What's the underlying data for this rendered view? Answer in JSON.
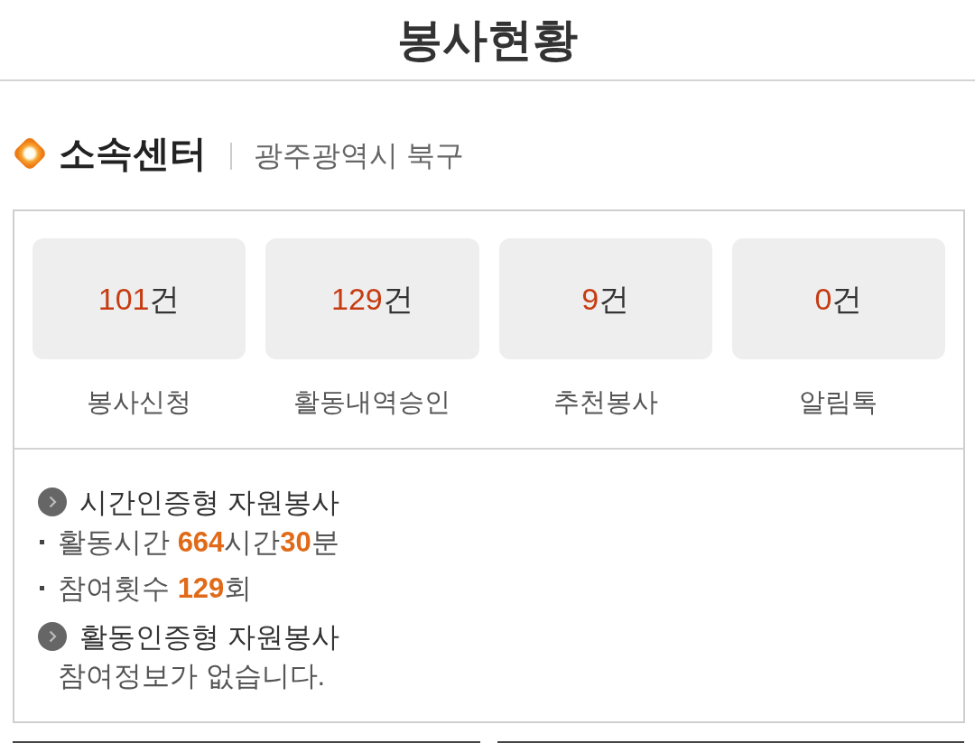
{
  "header": {
    "title": "봉사현황"
  },
  "center": {
    "label": "소속센터",
    "value": "광주광역시 북구"
  },
  "stats": [
    {
      "count": "101",
      "unit": "건",
      "label": "봉사신청"
    },
    {
      "count": "129",
      "unit": "건",
      "label": "활동내역승인"
    },
    {
      "count": "9",
      "unit": "건",
      "label": "추천봉사"
    },
    {
      "count": "0",
      "unit": "건",
      "label": "알림톡"
    }
  ],
  "records": [
    {
      "title": "시간인증형 자원봉사",
      "lines": [
        "활동시간 **664**시간**30**분",
        "참여횟수 **129**회"
      ]
    },
    {
      "title": "활동인증형 자원봉사",
      "message": "참여정보가 없습니다."
    }
  ]
}
